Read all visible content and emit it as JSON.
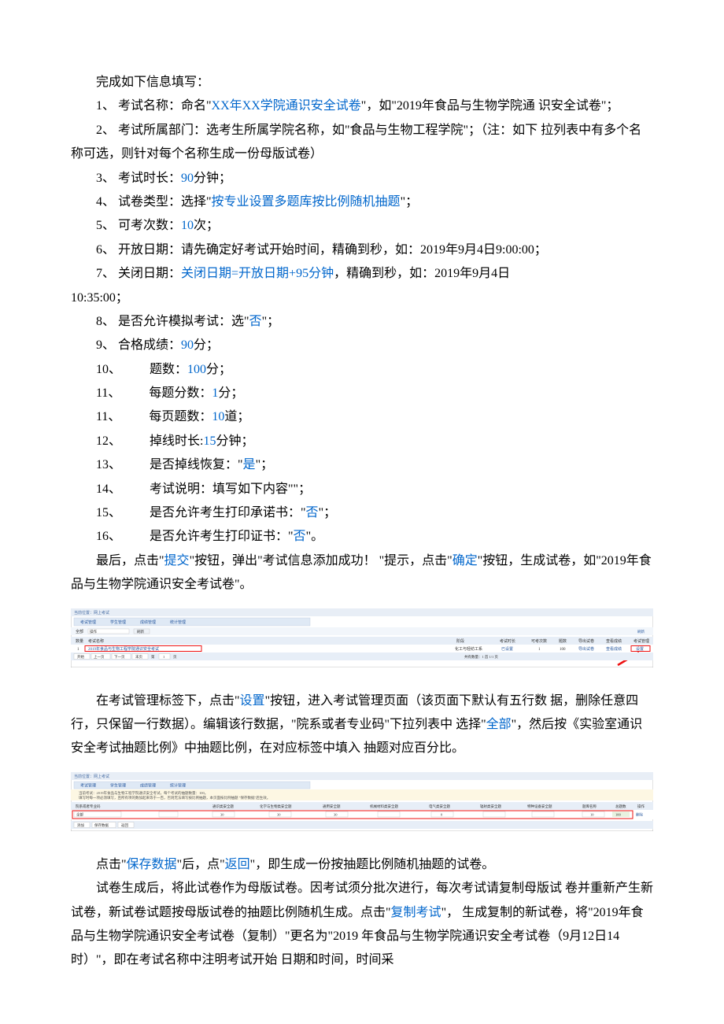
{
  "p_intro": "完成如下信息填写：",
  "p1_a": "1、 考试名称：命名\"",
  "p1_link": "XX年XX学院通识安全试卷",
  "p1_b": "\"，如\"2019年食品与生物学院通 识安全试卷\"；",
  "p2": "2、 考试所属部门：选考生所属学院名称，如\"食品与生物工程学院\"；（注：如下 拉列表中有多个名称可选，则针对每个名称生成一份母版试卷）",
  "p3_a": "3、 考试时长：",
  "p3_link": "90",
  "p3_b": "分钟；",
  "p4_a": "4、 试卷类型：选择\"",
  "p4_link": "按专业设置多题库按比例随机抽题",
  "p4_b": "\"；",
  "p5_a": "5、 可考次数：",
  "p5_link": "10",
  "p5_b": "次；",
  "p6": "6、 开放日期：请先确定好考试开始时间，精确到秒，如：2019年9月4日9:00:00；",
  "p7_a": "7、 关闭日期：",
  "p7_link": "关闭日期=开放日期+95分钟",
  "p7_b": "，精确到秒，如：2019年9月4日",
  "p7_c": "10:35:00；",
  "p8_a": "8、 是否允许模拟考试：选\"",
  "p8_link": "否",
  "p8_b": "\"；",
  "p9_a": "9、 合格成绩：",
  "p9_link": "90",
  "p9_b": "分；",
  "p10_a": "10、   题数：",
  "p10_link": "100",
  "p10_b": "分；",
  "p11_a": "11、   每题分数：",
  "p11_link": "1",
  "p11_b": "分；",
  "p11x_a": "11、   每页题数：",
  "p11x_link": "10",
  "p11x_b": "道；",
  "p12_a": "12、   掉线时长:",
  "p12_link": "15",
  "p12_b": "分钟；",
  "p13_a": "13、   是否掉线恢复：\"",
  "p13_link": "是",
  "p13_b": "\"；",
  "p14": "14、   考试说明：填写如下内容\"\"；",
  "p15_a": "15、   是否允许考生打印承诺书：\"",
  "p15_link": "否",
  "p15_b": "\"；",
  "p16_a": "16、   是否允许考生打印证书：\"",
  "p16_link": "否",
  "p16_b": "\"。",
  "p_submit_a": "最后，点击\"",
  "p_submit_link1": "提交",
  "p_submit_b": "\"按钮，弹出\"考试信息添加成功！ \"提示，点击\"",
  "p_submit_link2": "确定",
  "p_submit_c": "\"按钮，生成试卷，如\"2019年食品与生物学院通识安全考试卷\"。",
  "p_setting_a": "在考试管理标签下，点击\"",
  "p_setting_link1": "设置",
  "p_setting_b": "\"按钮，进入考试管理页面（该页面下默认有五行数 据，删除任意四行，只保留一行数据）。编辑该行数据，\"院系或者专业码\"下拉列表中 选择\"",
  "p_setting_link2": "全部",
  "p_setting_c": "\"，然后按《实验室通识安全考试抽题比例》中抽题比例，在对应标签中填入 抽题对应百分比。",
  "p_save_a": "点击\"",
  "p_save_link1": "保存数据",
  "p_save_b": "\"后，点\"",
  "p_save_link2": "返回",
  "p_save_c": "\"，即生成一份按抽题比例随机抽题的试卷。",
  "p_copy_a": "试卷生成后，将此试卷作为母版试卷。因考试须分批次进行，每次考试请复制母版试 卷并重新产生新试卷，新试卷试题按母版试卷的抽题比例随机生成。点击\"",
  "p_copy_link": "复制考试",
  "p_copy_b": "\"， 生成复制的新试卷，将\"2019年食品与生物学院通识安全考试卷（复制）\"更名为\"2019 年食品与生物学院通识安全考试卷（9月12日14时）\"，即在考试名称中注明考试开始 日期和时间，时间采",
  "screenshot1": {
    "breadcrumb": "当前位置：网上考试",
    "tabs": [
      "考试管理",
      "学生管理",
      "成绩管理",
      "统计管理"
    ],
    "filter_label": "全部",
    "operation_label": "操作",
    "refresh": "刷新",
    "headers": [
      "数量",
      "考试名称",
      "阶段",
      "考试时长",
      "可考次数",
      "题数",
      "导出试卷",
      "查看成绩",
      "考试管理"
    ],
    "row": {
      "num": "1",
      "name": "2019年食品与生物工程学院通识安全考试",
      "stage": "化工与轻纺工系",
      "phase": "已设置",
      "duration": "1",
      "count": "100",
      "export": "导出试卷",
      "view": "查看成绩",
      "manage": "设置"
    },
    "buttons": [
      "开始",
      "上一页",
      "下一页",
      "末页"
    ],
    "page_label": "第",
    "page_info": "共有数量：1 首 1/1 页",
    "page_value": "1",
    "page_unit": "页"
  },
  "screenshot2": {
    "breadcrumb": "当前位置：网上考试",
    "tabs": [
      "考试管理",
      "学生管理",
      "成绩管理",
      "统计管理"
    ],
    "info_line1": "当前考试：2019年食品与生物工程学院通识安全考试，每个考试的抽题数量：100。",
    "info_line2": "填写时每一项必须填写，且所有项的数加起来等于一百，否则无法填写按比例抽题，本页面按比例抽题 \"保存数据\"后生效。",
    "headers": [
      "院系或者专业码",
      "通识类安全题",
      "化学与生物类安全题",
      "通用安全题",
      "机械材料类安全题",
      "电气类安全题",
      "辐射类安全题",
      "特种设备安全题",
      "题库名称",
      "总题数",
      "操作"
    ],
    "row": {
      "dept": "全部",
      "c1": "30",
      "c2": "30",
      "c3": "30",
      "c4": "",
      "c5": "0",
      "c6": "",
      "c7": "",
      "c8": "",
      "c9": "10",
      "total": "100",
      "op": "删除"
    },
    "buttons": [
      "添加",
      "保存数据",
      "返回"
    ]
  }
}
